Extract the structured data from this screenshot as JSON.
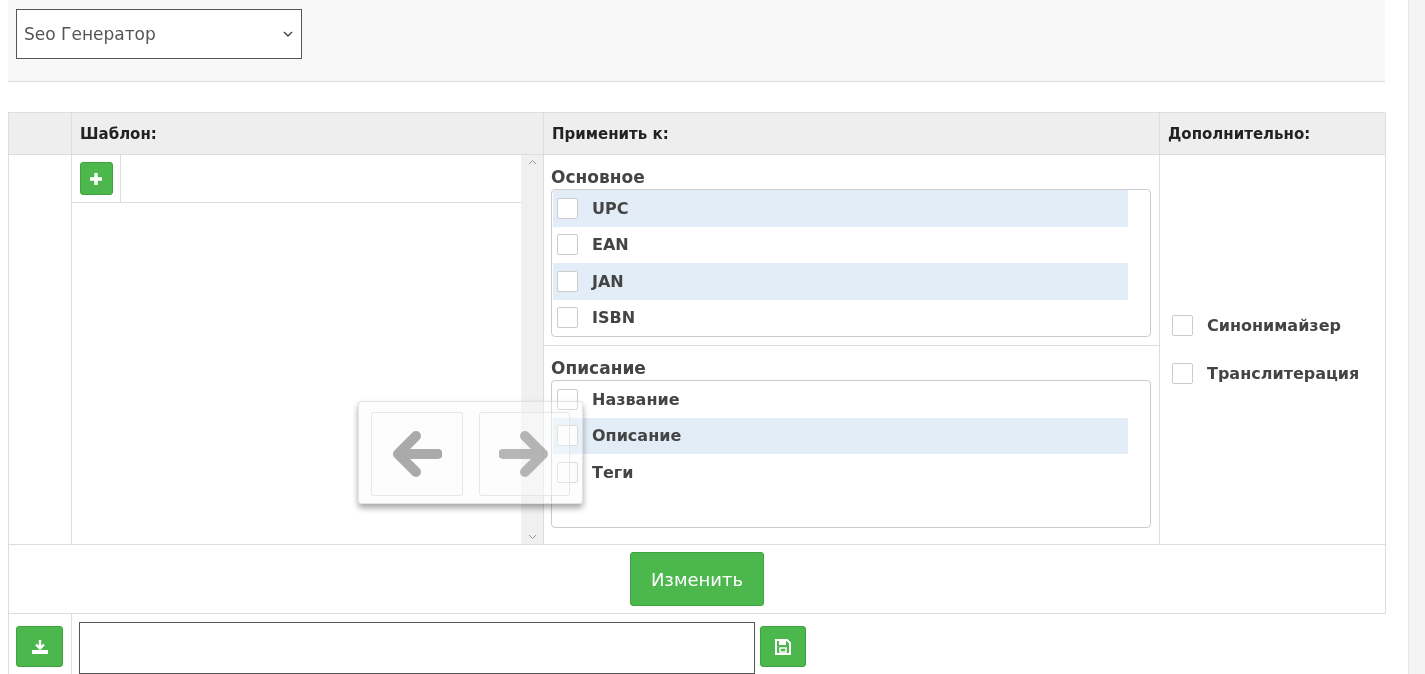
{
  "selector": {
    "value": "Seo Генератор"
  },
  "table": {
    "columns": [
      "Шаблон:",
      "Применить к:",
      "Дополнительно:"
    ],
    "apply_groups": [
      {
        "title": "Основное",
        "items": [
          {
            "label": "UPC",
            "checked": false,
            "highlighted": true
          },
          {
            "label": "EAN",
            "checked": false,
            "highlighted": false
          },
          {
            "label": "JAN",
            "checked": false,
            "highlighted": true
          },
          {
            "label": "ISBN",
            "checked": false,
            "highlighted": false
          }
        ]
      },
      {
        "title": "Описание",
        "items": [
          {
            "label": "Название",
            "checked": false,
            "highlighted": false
          },
          {
            "label": "Описание",
            "checked": false,
            "highlighted": true
          },
          {
            "label": "Теги",
            "checked": false,
            "highlighted": false
          }
        ]
      }
    ],
    "extra_options": [
      {
        "label": "Синонимайзер",
        "checked": false
      },
      {
        "label": "Транслитерация",
        "checked": false
      }
    ],
    "submit_button": "Изменить"
  }
}
